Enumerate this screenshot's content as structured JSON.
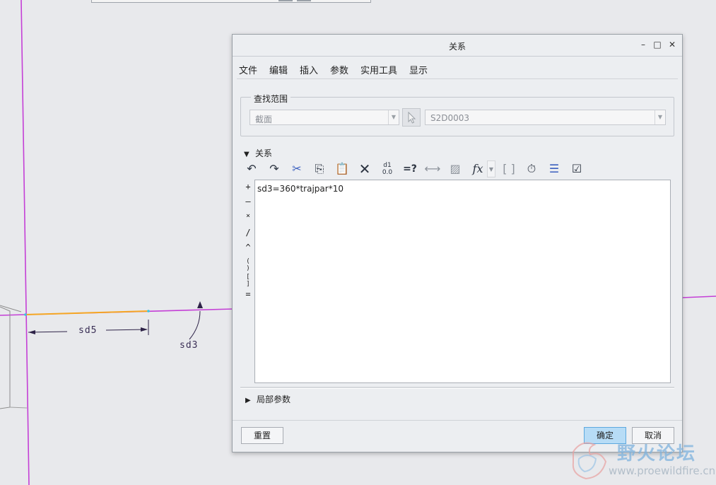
{
  "cad": {
    "dim_labels": [
      "sd5",
      "sd3"
    ]
  },
  "dialog": {
    "title": "关系",
    "window_buttons": {
      "minimize": "–",
      "maximize": "□",
      "close": "✕"
    },
    "menu": [
      "文件",
      "编辑",
      "插入",
      "参数",
      "实用工具",
      "显示"
    ],
    "search_scope": {
      "label": "查找范围",
      "type_value": "截面",
      "object_value": "S2D0003"
    },
    "relations": {
      "label": "关系",
      "text": "sd3=360*trajpar*10"
    },
    "operators": [
      "+",
      "–",
      "×",
      "/",
      "^",
      "( )",
      "[ ]",
      "="
    ],
    "toolbar_icons": [
      "undo-icon",
      "redo-icon",
      "cut-icon",
      "copy-icon",
      "paste-icon",
      "delete-icon",
      "switch-dims-icon",
      "evaluate-icon",
      "show-dims-icon",
      "section-icon",
      "function-icon",
      "brackets-icon",
      "verify-icon",
      "sort-icon",
      "execute-icon"
    ],
    "local_params": {
      "label": "局部参数"
    },
    "buttons": {
      "reset": "重置",
      "ok": "确定",
      "cancel": "取消"
    }
  },
  "watermark": {
    "title": "野火论坛",
    "url": "www.proewildfire.cn"
  },
  "colors": {
    "axis": "#c43fd6",
    "sketch": "#f5a623",
    "dim": "#2e2348",
    "ok_button": "#b7dcf6"
  }
}
